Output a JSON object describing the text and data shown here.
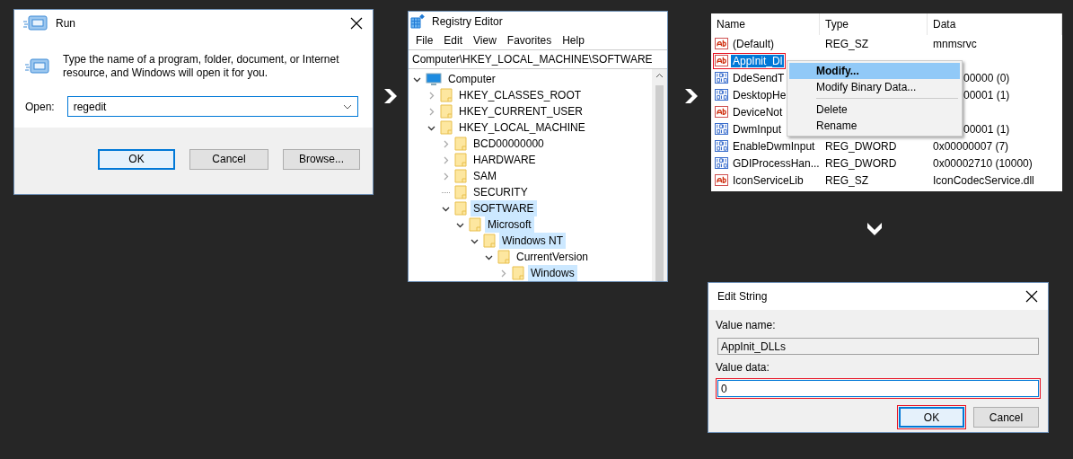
{
  "run": {
    "title": "Run",
    "prompt": "Type the name of a program, folder, document, or Internet resource, and Windows will open it for you.",
    "open_label": "Open:",
    "open_value": "regedit",
    "buttons": [
      {
        "label": "OK",
        "default": true
      },
      {
        "label": "Cancel",
        "default": false
      },
      {
        "label": "Browse...",
        "default": false
      }
    ]
  },
  "registry": {
    "title": "Registry Editor",
    "menu": [
      "File",
      "Edit",
      "View",
      "Favorites",
      "Help"
    ],
    "address": "Computer\\HKEY_LOCAL_MACHINE\\SOFTWARE",
    "tree": [
      {
        "label": "Computer",
        "kind": "computer",
        "expandable": true,
        "expanded": true,
        "selected": false,
        "children": [
          {
            "label": "HKEY_CLASSES_ROOT",
            "kind": "folder",
            "expandable": true,
            "expanded": false,
            "selected": false
          },
          {
            "label": "HKEY_CURRENT_USER",
            "kind": "folder",
            "expandable": true,
            "expanded": false,
            "selected": false
          },
          {
            "label": "HKEY_LOCAL_MACHINE",
            "kind": "folder",
            "expandable": true,
            "expanded": true,
            "selected": false,
            "children": [
              {
                "label": "BCD00000000",
                "kind": "folder",
                "expandable": true,
                "expanded": false,
                "selected": false
              },
              {
                "label": "HARDWARE",
                "kind": "folder",
                "expandable": true,
                "expanded": false,
                "selected": false
              },
              {
                "label": "SAM",
                "kind": "folder",
                "expandable": true,
                "expanded": false,
                "selected": false
              },
              {
                "label": "SECURITY",
                "kind": "folder",
                "expandable": false,
                "selected": false
              },
              {
                "label": "SOFTWARE",
                "kind": "folder",
                "expandable": true,
                "expanded": true,
                "selected": true,
                "children": [
                  {
                    "label": "Microsoft",
                    "kind": "folder",
                    "expandable": true,
                    "expanded": true,
                    "selected": true,
                    "children": [
                      {
                        "label": "Windows NT",
                        "kind": "folder",
                        "expandable": true,
                        "expanded": true,
                        "selected": true,
                        "children": [
                          {
                            "label": "CurrentVersion",
                            "kind": "folder",
                            "expandable": true,
                            "expanded": true,
                            "selected": false,
                            "children": [
                              {
                                "label": "Windows",
                                "kind": "folder",
                                "expandable": true,
                                "expanded": false,
                                "selected": true
                              }
                            ]
                          }
                        ]
                      }
                    ]
                  }
                ]
              }
            ]
          }
        ]
      }
    ]
  },
  "values": {
    "columns": [
      "Name",
      "Type",
      "Data"
    ],
    "rows": [
      {
        "name": "(Default)",
        "type": "REG_SZ",
        "data": "mnmsrvc",
        "kind": "string",
        "selected": false,
        "highlighted": false
      },
      {
        "name": "AppInit_Dl",
        "kind": "string",
        "selected": true,
        "highlighted": true
      },
      {
        "name": "DdeSendT",
        "data": "00000 (0)",
        "kind": "binary",
        "selected": false,
        "highlighted": false,
        "covered": true
      },
      {
        "name": "DesktopHe",
        "data": "00001 (1)",
        "kind": "binary",
        "selected": false,
        "highlighted": false,
        "covered": true
      },
      {
        "name": "DeviceNot",
        "kind": "string",
        "selected": false,
        "highlighted": false
      },
      {
        "name": "DwmInput",
        "data": "00001 (1)",
        "kind": "binary",
        "selected": false,
        "highlighted": false,
        "covered": true
      },
      {
        "name": "EnableDwmInput",
        "type": "REG_DWORD",
        "data": "0x00000007 (7)",
        "kind": "binary",
        "selected": false,
        "highlighted": false,
        "covered": false
      },
      {
        "name": "GDIProcessHan...",
        "type": "REG_DWORD",
        "data": "0x00002710 (10000)",
        "kind": "binary",
        "selected": false,
        "highlighted": false,
        "covered": false
      },
      {
        "name": "IconServiceLib",
        "type": "REG_SZ",
        "data": "IconCodecService.dll",
        "kind": "string",
        "selected": false,
        "highlighted": false,
        "covered": false
      }
    ],
    "context_menu": [
      {
        "label": "Modify...",
        "kind": "item",
        "selected": true
      },
      {
        "label": "Modify Binary Data...",
        "kind": "item",
        "selected": false
      },
      {
        "kind": "separator"
      },
      {
        "label": "Delete",
        "kind": "item",
        "selected": false
      },
      {
        "label": "Rename",
        "kind": "item",
        "selected": false
      }
    ]
  },
  "edit_string": {
    "title": "Edit String",
    "value_name_label": "Value name:",
    "value_name": "AppInit_DLLs",
    "value_data_label": "Value data:",
    "value_data": "0",
    "value_data_highlighted": true,
    "buttons": [
      {
        "label": "OK",
        "default": true,
        "highlighted": true
      },
      {
        "label": "Cancel",
        "default": false,
        "highlighted": false
      }
    ]
  }
}
